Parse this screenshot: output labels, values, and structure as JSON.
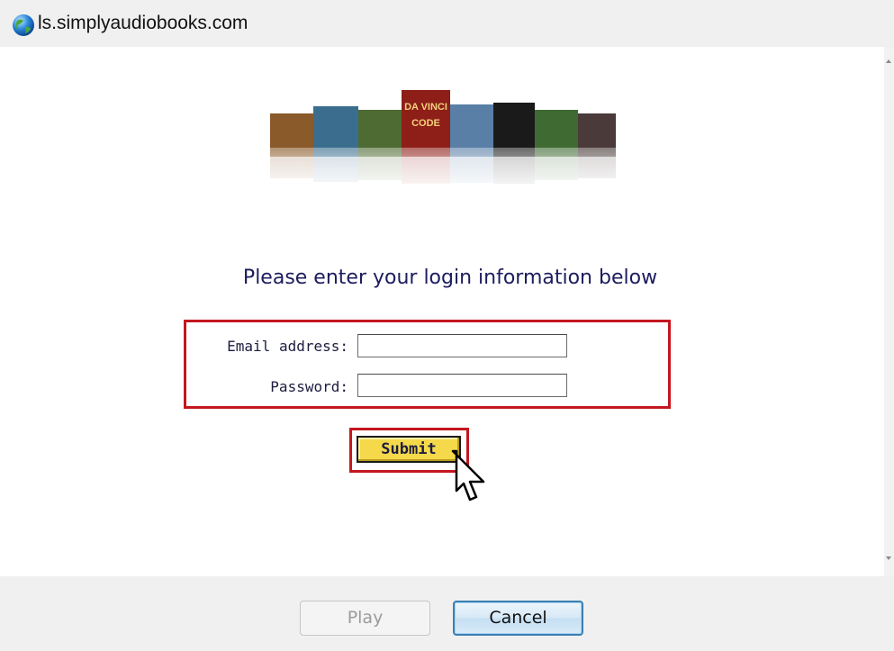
{
  "window": {
    "title": "ls.simplyaudiobooks.com"
  },
  "banner": {
    "books": [
      {
        "name": "book-1",
        "color": "#8a5a2a"
      },
      {
        "name": "book-2",
        "color": "#3b6e8e"
      },
      {
        "name": "book-3",
        "color": "#4e6b33"
      },
      {
        "name": "book-davinci",
        "color": "#8e1e18",
        "text": "DA VINCI CODE"
      },
      {
        "name": "book-5",
        "color": "#5a7fa6"
      },
      {
        "name": "book-6",
        "color": "#1a1a1a"
      },
      {
        "name": "book-7",
        "color": "#3f6b33"
      },
      {
        "name": "book-8",
        "color": "#4a3a3a"
      }
    ]
  },
  "form": {
    "heading": "Please enter your login information below",
    "email_label": "Email address:",
    "email_value": "",
    "password_label": "Password:",
    "password_value": "",
    "submit_label": "Submit"
  },
  "footer": {
    "play_label": "Play",
    "cancel_label": "Cancel"
  },
  "colors": {
    "highlight_red": "#c4171e",
    "heading_navy": "#1c1c5e",
    "submit_yellow": "#f5d94a"
  }
}
